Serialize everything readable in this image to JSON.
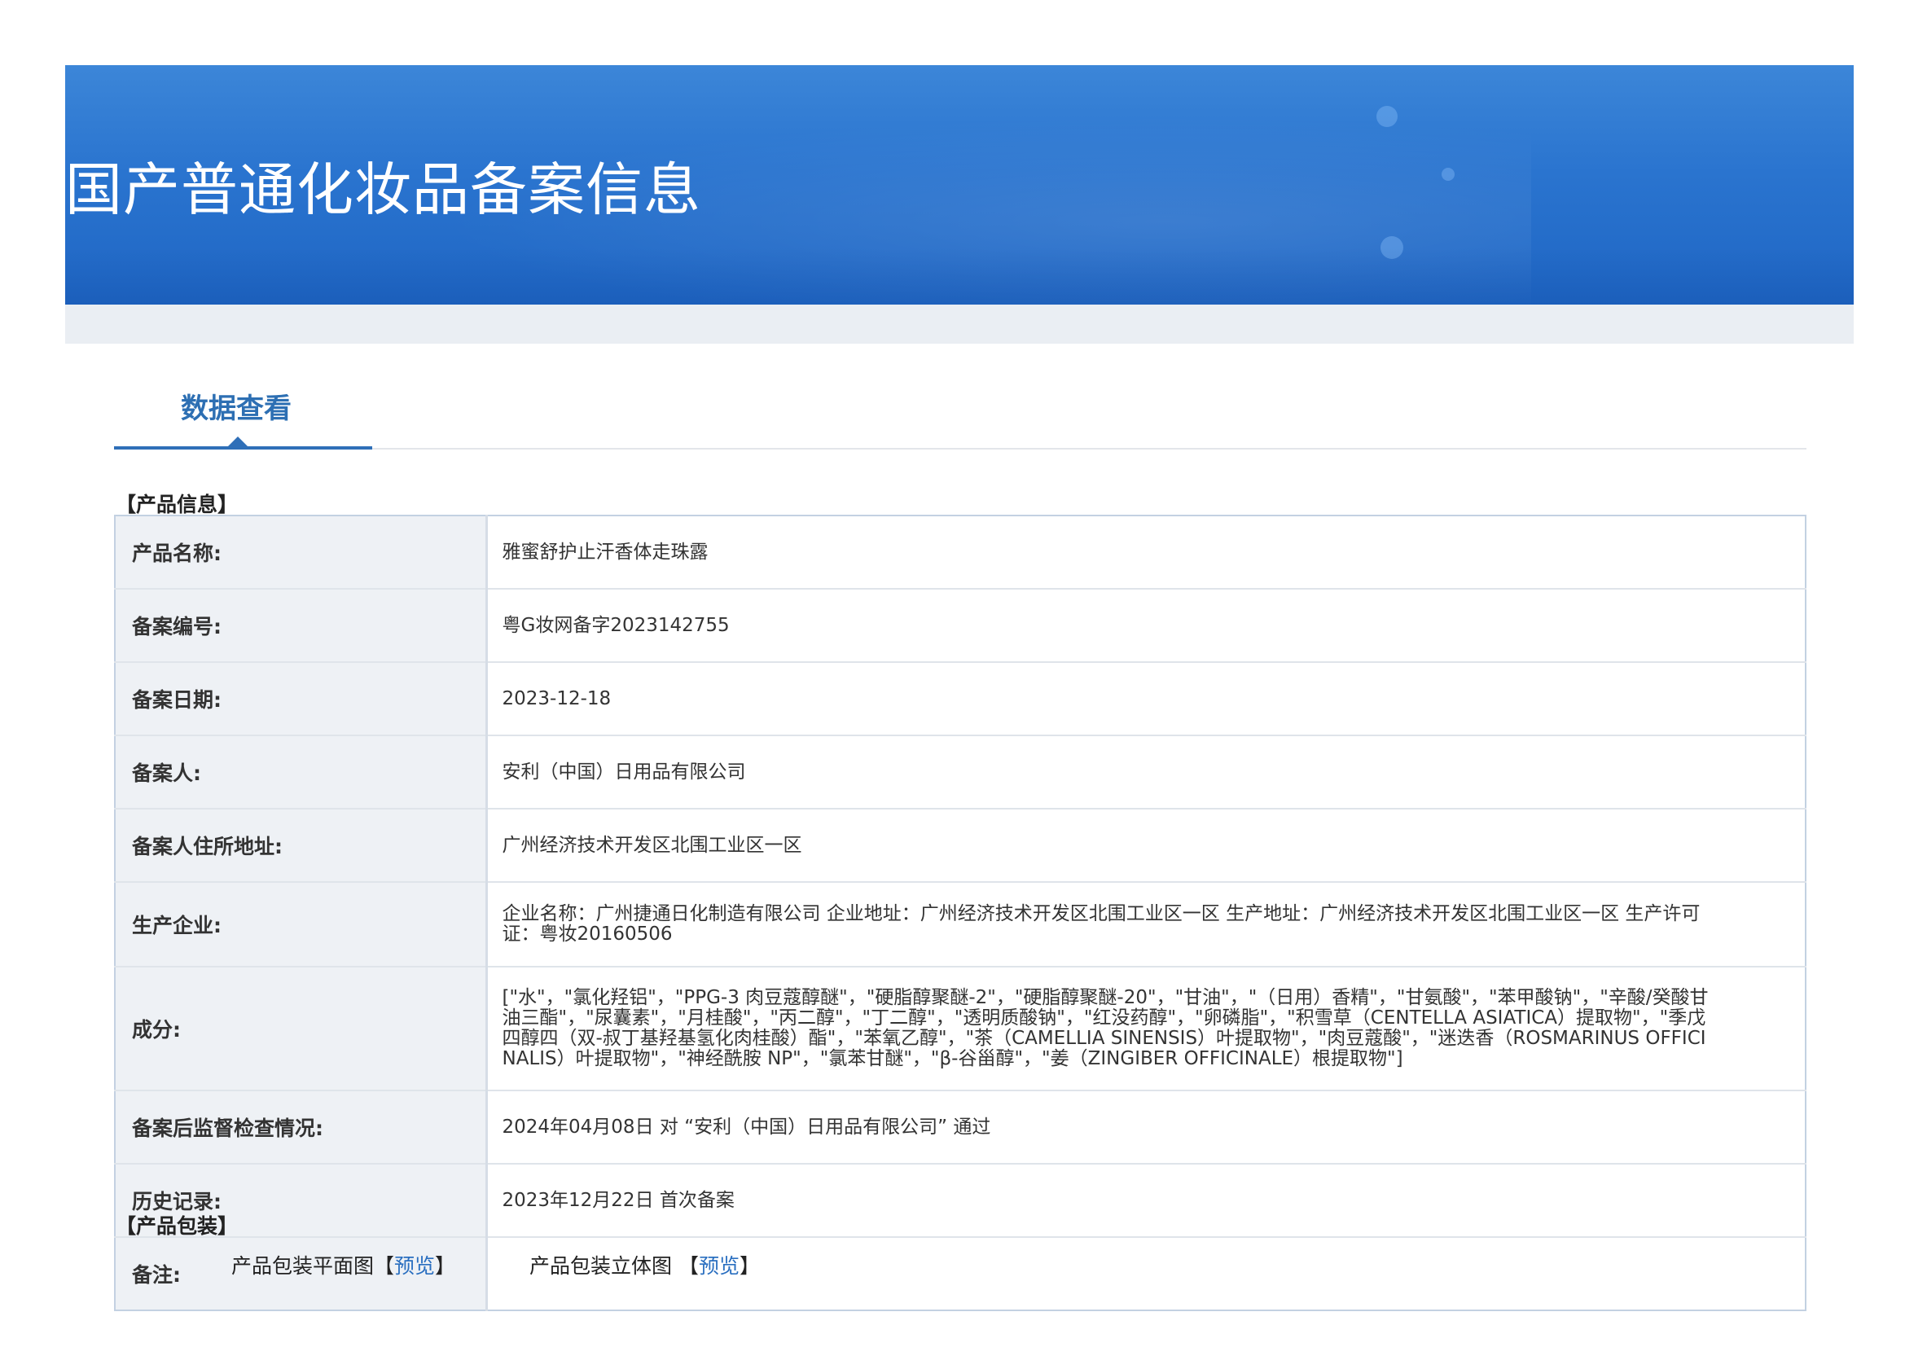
{
  "header": {
    "title": "国产普通化妆品备案信息"
  },
  "tabs": [
    {
      "label": "数据查看",
      "active": true
    }
  ],
  "product_info": {
    "heading": "【产品信息】",
    "rows": [
      {
        "label": "产品名称:",
        "value": "雅蜜舒护止汗香体走珠露"
      },
      {
        "label": "备案编号:",
        "value": "粤G妆网备字2023142755"
      },
      {
        "label": "备案日期:",
        "value": "2023-12-18"
      },
      {
        "label": "备案人:",
        "value": "安利（中国）日用品有限公司"
      },
      {
        "label": "备案人住所地址:",
        "value": "广州经济技术开发区北围工业区一区"
      },
      {
        "label": "生产企业:",
        "value": "企业名称：广州捷通日化制造有限公司 企业地址：广州经济技术开发区北围工业区一区 生产地址：广州经济技术开发区北围工业区一区 生产许可证：粤妆20160506"
      },
      {
        "label": "成分:",
        "value": "[\"水\"，\"氯化羟铝\"，\"PPG-3 肉豆蔻醇醚\"，\"硬脂醇聚醚-2\"，\"硬脂醇聚醚-20\"，\"甘油\"，\"（日用）香精\"，\"甘氨酸\"，\"苯甲酸钠\"，\"辛酸/癸酸甘油三酯\"，\"尿囊素\"，\"月桂酸\"，\"丙二醇\"，\"丁二醇\"，\"透明质酸钠\"，\"红没药醇\"，\"卵磷脂\"，\"积雪草（CENTELLA ASIATICA）提取物\"，\"季戊四醇四（双-叔丁基羟基氢化肉桂酸）酯\"，\"苯氧乙醇\"，\"茶（CAMELLIA SINENSIS）叶提取物\"，\"肉豆蔻酸\"，\"迷迭香（ROSMARINUS OFFICINALIS）叶提取物\"，\"神经酰胺 NP\"，\"氯苯甘醚\"，\"β-谷甾醇\"，\"姜（ZINGIBER OFFICINALE）根提取物\"]"
      },
      {
        "label": "备案后监督检查情况:",
        "value": "2024年04月08日 对 “安利（中国）日用品有限公司” 通过"
      },
      {
        "label": "历史记录:",
        "value": "2023年12月22日 首次备案"
      },
      {
        "label": "备注:",
        "value": ""
      }
    ]
  },
  "product_packaging": {
    "heading": "【产品包装】",
    "items": [
      {
        "label": "产品包装平面图",
        "bracket_open": "【",
        "link": "预览",
        "bracket_close": "】"
      },
      {
        "label": "产品包装立体图 ",
        "bracket_open": "【",
        "link": "预览",
        "bracket_close": "】"
      }
    ]
  },
  "colors": {
    "banner": "#2a74cf",
    "accent": "#2d6fb3",
    "link": "#2a6fc0",
    "label_bg": "#eef1f5",
    "border": "#c3d1e2"
  }
}
